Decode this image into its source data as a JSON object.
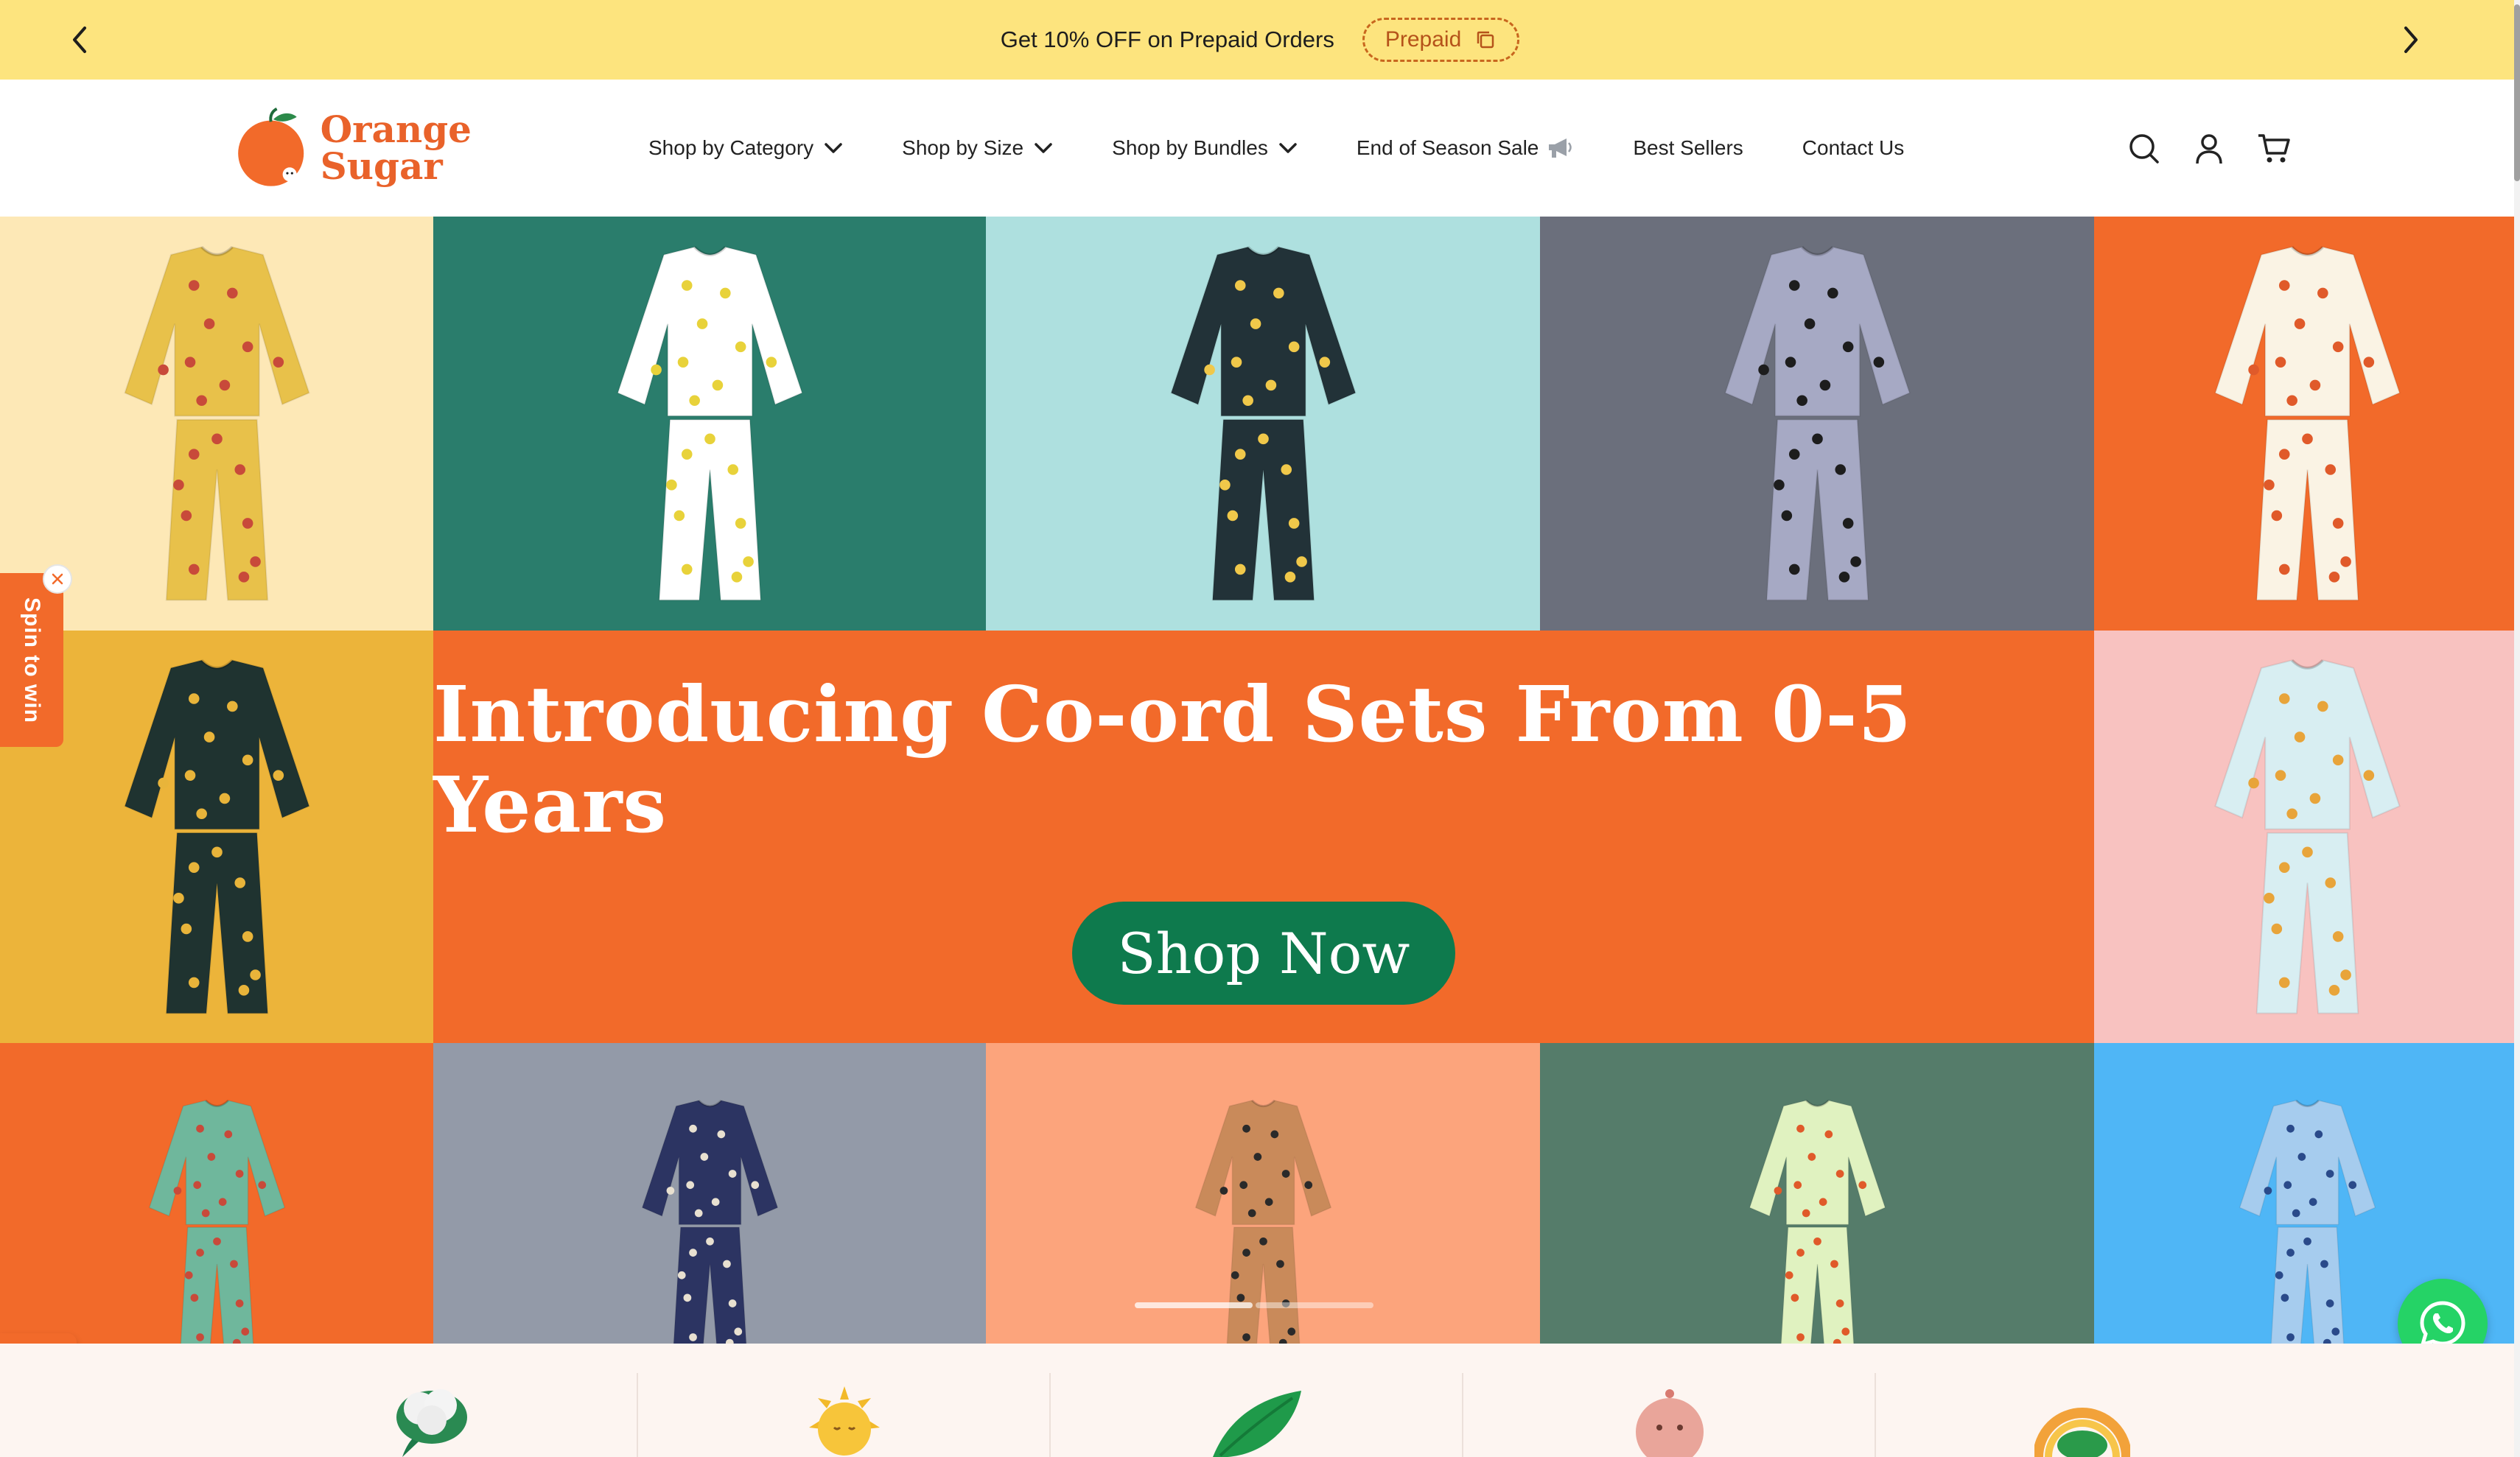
{
  "announcement": {
    "message": "Get 10% OFF on Prepaid Orders",
    "code_label": "Prepaid"
  },
  "header": {
    "logo_line1": "Orange",
    "logo_line2": "Sugar",
    "nav": [
      {
        "label": "Shop by Category"
      },
      {
        "label": "Shop by Size"
      },
      {
        "label": "Shop by Bundles"
      },
      {
        "label": "End of Season Sale"
      },
      {
        "label": "Best Sellers"
      },
      {
        "label": "Contact Us"
      }
    ]
  },
  "hero": {
    "headline": "Introducing Co-ord Sets From 0-5 Years",
    "cta": "Shop Now"
  },
  "tiles": [
    {
      "bg": "#fde8b6",
      "pj": "#e8c14a",
      "dots": "#c84a3a"
    },
    {
      "bg": "#2a7d6c",
      "pj": "#ffffff",
      "dots": "#e8d23a"
    },
    {
      "bg": "#aee0df",
      "pj": "#223238",
      "dots": "#f0c84a"
    },
    {
      "bg": "#6b6f7c",
      "pj": "#a6a9c4",
      "dots": "#1d1d1d"
    },
    {
      "bg": "#f26a2a",
      "pj": "#faf3e4",
      "dots": "#e05a2a"
    },
    {
      "bg": "#ecb43a",
      "pj": "#1f3330",
      "dots": "#e8b43a"
    },
    {
      "bg": "#f8c2c0",
      "pj": "#d8eef2",
      "dots": "#e8a43a"
    },
    {
      "bg": "#f26a2a",
      "pj": "#6fb79c",
      "dots": "#c84a3a"
    },
    {
      "bg": "#939aa8",
      "pj": "#2c3462",
      "dots": "#e8e0d0"
    },
    {
      "bg": "#fca47c",
      "pj": "#c98a5a",
      "dots": "#2a2a2a"
    },
    {
      "bg": "#557c6a",
      "pj": "#e0f2c0",
      "dots": "#e05a2a"
    },
    {
      "bg": "#4fb6f6",
      "pj": "#a6ccee",
      "dots": "#2a4a8a"
    }
  ],
  "widgets": {
    "spin_label": "Spin to win"
  },
  "colors": {
    "announce_bg": "#fde47e",
    "brand_orange": "#f26a2a",
    "cta_green": "#0e7a4d",
    "whatsapp": "#25d366"
  },
  "icons": {
    "prev": "chevron-left-icon",
    "next": "chevron-right-icon",
    "copy": "copy-icon",
    "search": "search-icon",
    "account": "user-icon",
    "cart": "cart-icon",
    "megaphone": "megaphone-icon",
    "gift": "gift-icon",
    "whatsapp": "whatsapp-icon"
  }
}
